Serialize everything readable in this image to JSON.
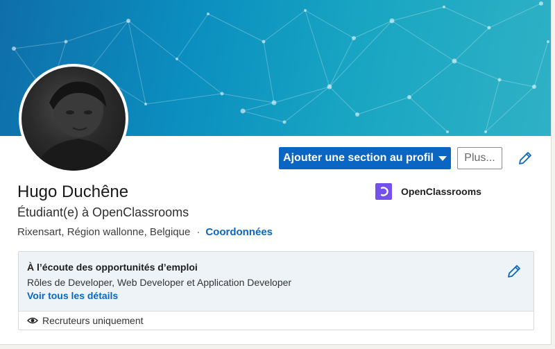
{
  "profile": {
    "name": "Hugo Duchêne",
    "headline": "Étudiant(e) à OpenClassrooms",
    "location": "Rixensart, Région wallonne, Belgique",
    "separator": "·",
    "contact_link": "Coordonnées"
  },
  "actions": {
    "add_section_label": "Ajouter une section au profil",
    "more_label": "Plus..."
  },
  "company": {
    "name": "OpenClassrooms",
    "logo_color": "#7451eb"
  },
  "open_to_work": {
    "title": "À l’écoute des opportunités d’emploi",
    "roles": "Rôles de Developer, Web Developer et Application Developer",
    "details_link": "Voir tous les détails",
    "visibility": "Recruteurs uniquement"
  },
  "colors": {
    "accent": "#0a66c2",
    "banner": "#0b8fc0"
  }
}
